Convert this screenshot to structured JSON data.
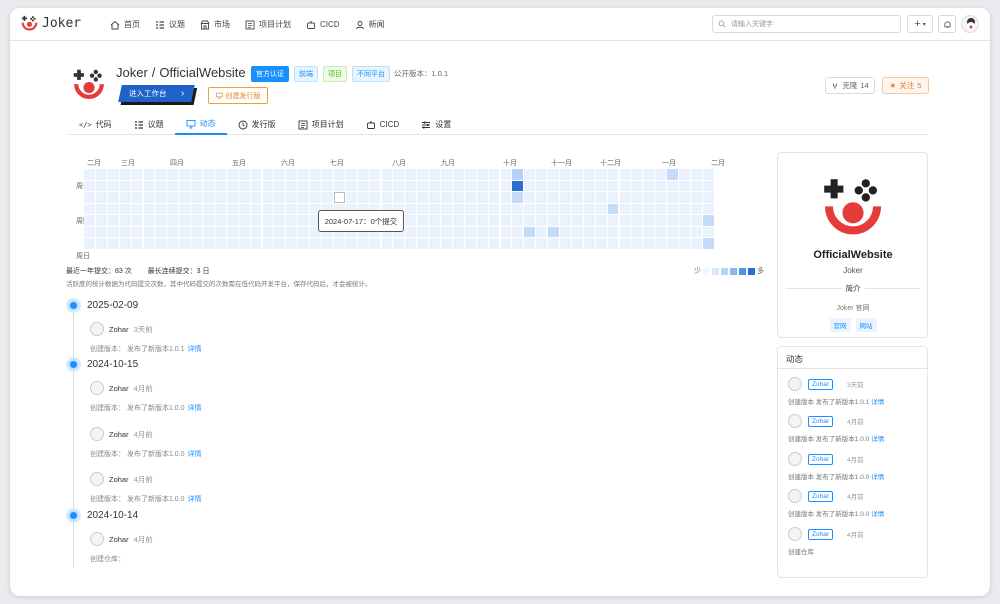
{
  "brand": {
    "name": "Joker"
  },
  "nav": [
    {
      "label": "首页",
      "icon": "home-icon"
    },
    {
      "label": "议题",
      "icon": "list-icon"
    },
    {
      "label": "市场",
      "icon": "store-icon"
    },
    {
      "label": "项目计划",
      "icon": "plan-icon"
    },
    {
      "label": "CICD",
      "icon": "robot-icon"
    },
    {
      "label": "新闻",
      "icon": "user-icon"
    }
  ],
  "search": {
    "placeholder": "请输入关键字"
  },
  "repo": {
    "owner": "Joker",
    "sep": "/",
    "name": "OfficialWebsite",
    "tags": [
      "官方认证",
      "前端",
      "项目",
      "不同平台"
    ],
    "version_label": "公开版本：",
    "version": "1.0.1",
    "enter_label": "进入工作台",
    "release_label": "创建发行版",
    "clone_label": "克隆",
    "clone_count": "14",
    "follow_label": "关注",
    "follow_count": "5"
  },
  "tabs": [
    {
      "label": "代码",
      "icon": "code-icon"
    },
    {
      "label": "议题",
      "icon": "list-icon"
    },
    {
      "label": "动态",
      "icon": "monitor-icon"
    },
    {
      "label": "发行版",
      "icon": "clock-icon"
    },
    {
      "label": "项目计划",
      "icon": "plan-icon"
    },
    {
      "label": "CICD",
      "icon": "robot-icon"
    },
    {
      "label": "设置",
      "icon": "sliders-icon"
    }
  ],
  "heatmap": {
    "months": [
      "二月",
      "三月",
      "四月",
      "五月",
      "六月",
      "七月",
      "八月",
      "九月",
      "十月",
      "十一月",
      "十二月",
      "一月",
      "二月"
    ],
    "days": [
      "周一",
      "周四",
      "周日"
    ],
    "tooltip": "2024-07-17：0个提交",
    "year_commits_label": "最近一年提交：",
    "year_commits": "83 次",
    "streak_label": "最长连续提交：",
    "streak": "3 日",
    "note": "活跃度的统计数据为代码提交次数，其中代码提交的次数需在低代码开发平台，保存代码后，才会被统计。",
    "legend_less": "少",
    "legend_more": "多"
  },
  "timeline": [
    {
      "date": "2025-02-09",
      "entries": [
        {
          "user": "Zohar",
          "time": "3天前",
          "desc": "创建版本：  发布了新版本1.0.1",
          "link": "详情"
        }
      ]
    },
    {
      "date": "2024-10-15",
      "entries": [
        {
          "user": "Zohar",
          "time": "4月前",
          "desc": "创建版本：  发布了新版本1.0.0",
          "link": "详情"
        },
        {
          "user": "Zohar",
          "time": "4月前",
          "desc": "创建版本：  发布了新版本1.0.0",
          "link": "详情"
        },
        {
          "user": "Zohar",
          "time": "4月前",
          "desc": "创建版本：  发布了新版本1.0.0",
          "link": "详情"
        }
      ]
    },
    {
      "date": "2024-10-14",
      "entries": [
        {
          "user": "Zohar",
          "time": "4月前",
          "desc": "创建仓库：",
          "link": ""
        }
      ]
    }
  ],
  "profile": {
    "name": "OfficialWebsite",
    "owner": "Joker",
    "section": "简介",
    "desc": "Joker 官网",
    "tags": [
      "官网",
      "网站"
    ]
  },
  "activity": {
    "title": "动态",
    "items": [
      {
        "user": "Zohar",
        "time": "3天前",
        "desc": "创建版本 发布了新版本1.0.1",
        "link": "详情"
      },
      {
        "user": "Zohar",
        "time": "4月前",
        "desc": "创建版本 发布了新版本1.0.0",
        "link": "详情"
      },
      {
        "user": "Zohar",
        "time": "4月前",
        "desc": "创建版本 发布了新版本1.0.0",
        "link": "详情"
      },
      {
        "user": "Zohar",
        "time": "4月前",
        "desc": "创建版本 发布了新版本1.0.0",
        "link": "详情"
      },
      {
        "user": "Zohar",
        "time": "4月前",
        "desc": "创建仓库",
        "link": ""
      }
    ]
  },
  "colors": {
    "accent": "#1890ff",
    "heat_empty": "#eaf3fd",
    "heat_low": "#c4dcf8",
    "heat_high": "#2a6fcf"
  }
}
